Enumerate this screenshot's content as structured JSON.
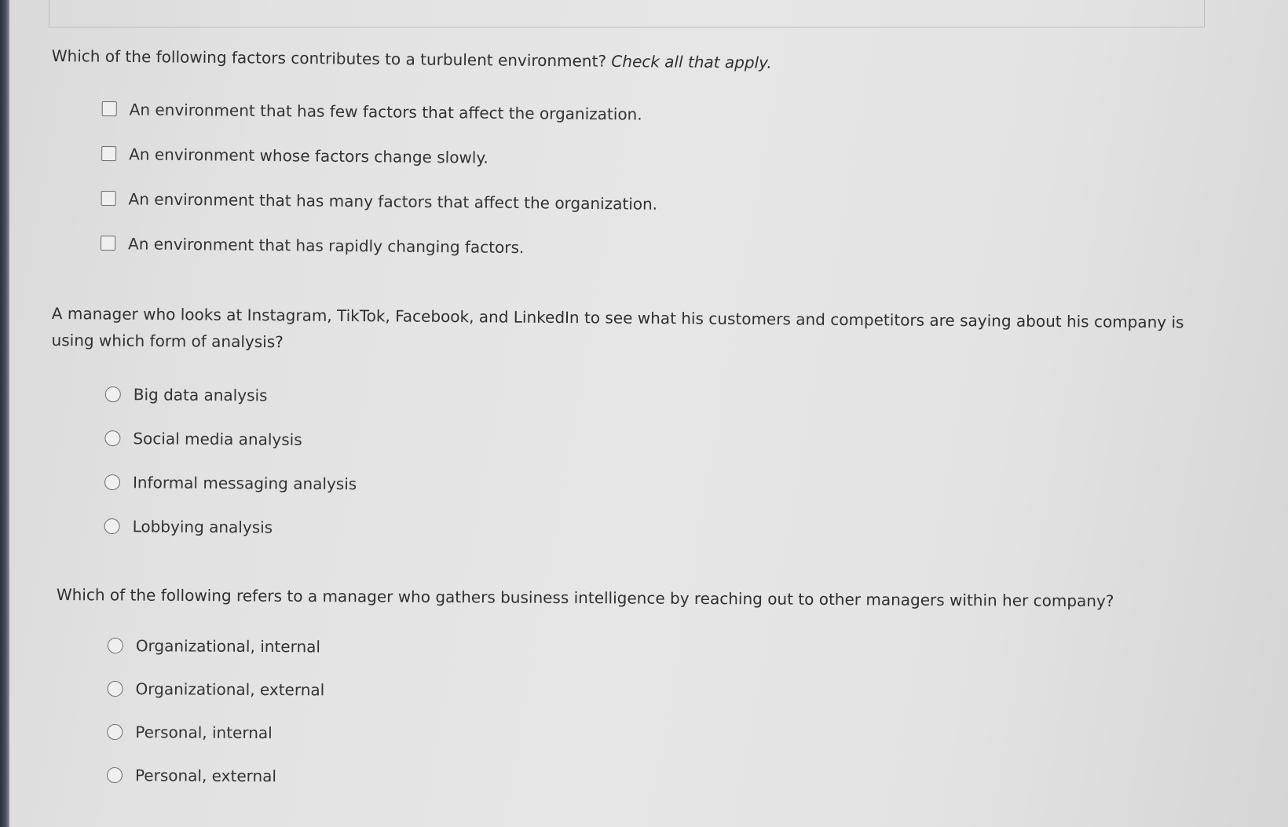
{
  "questions": [
    {
      "type": "checkbox",
      "prompt": "Which of the following factors contributes to a turbulent environment?",
      "instruction": "Check all that apply.",
      "options": [
        {
          "label": "An environment that has few factors that affect the organization.",
          "checked": false
        },
        {
          "label": "An environment whose factors change slowly.",
          "checked": false
        },
        {
          "label": "An environment that has many factors that affect the organization.",
          "checked": false
        },
        {
          "label": "An environment that has rapidly changing factors.",
          "checked": false
        }
      ]
    },
    {
      "type": "radio",
      "prompt": "A manager who looks at Instagram, TikTok, Facebook, and LinkedIn to see what his customers and competitors are saying about his company is using which form of analysis?",
      "options": [
        {
          "label": "Big data analysis",
          "selected": false
        },
        {
          "label": "Social media analysis",
          "selected": false
        },
        {
          "label": "Informal messaging analysis",
          "selected": false
        },
        {
          "label": "Lobbying analysis",
          "selected": false
        }
      ]
    },
    {
      "type": "radio",
      "prompt": "Which of the following refers to a manager who gathers business intelligence by reaching out to other managers within her company?",
      "options": [
        {
          "label": "Organizational, internal",
          "selected": false
        },
        {
          "label": "Organizational, external",
          "selected": false
        },
        {
          "label": "Personal, internal",
          "selected": false
        },
        {
          "label": "Personal, external",
          "selected": false
        }
      ]
    }
  ]
}
